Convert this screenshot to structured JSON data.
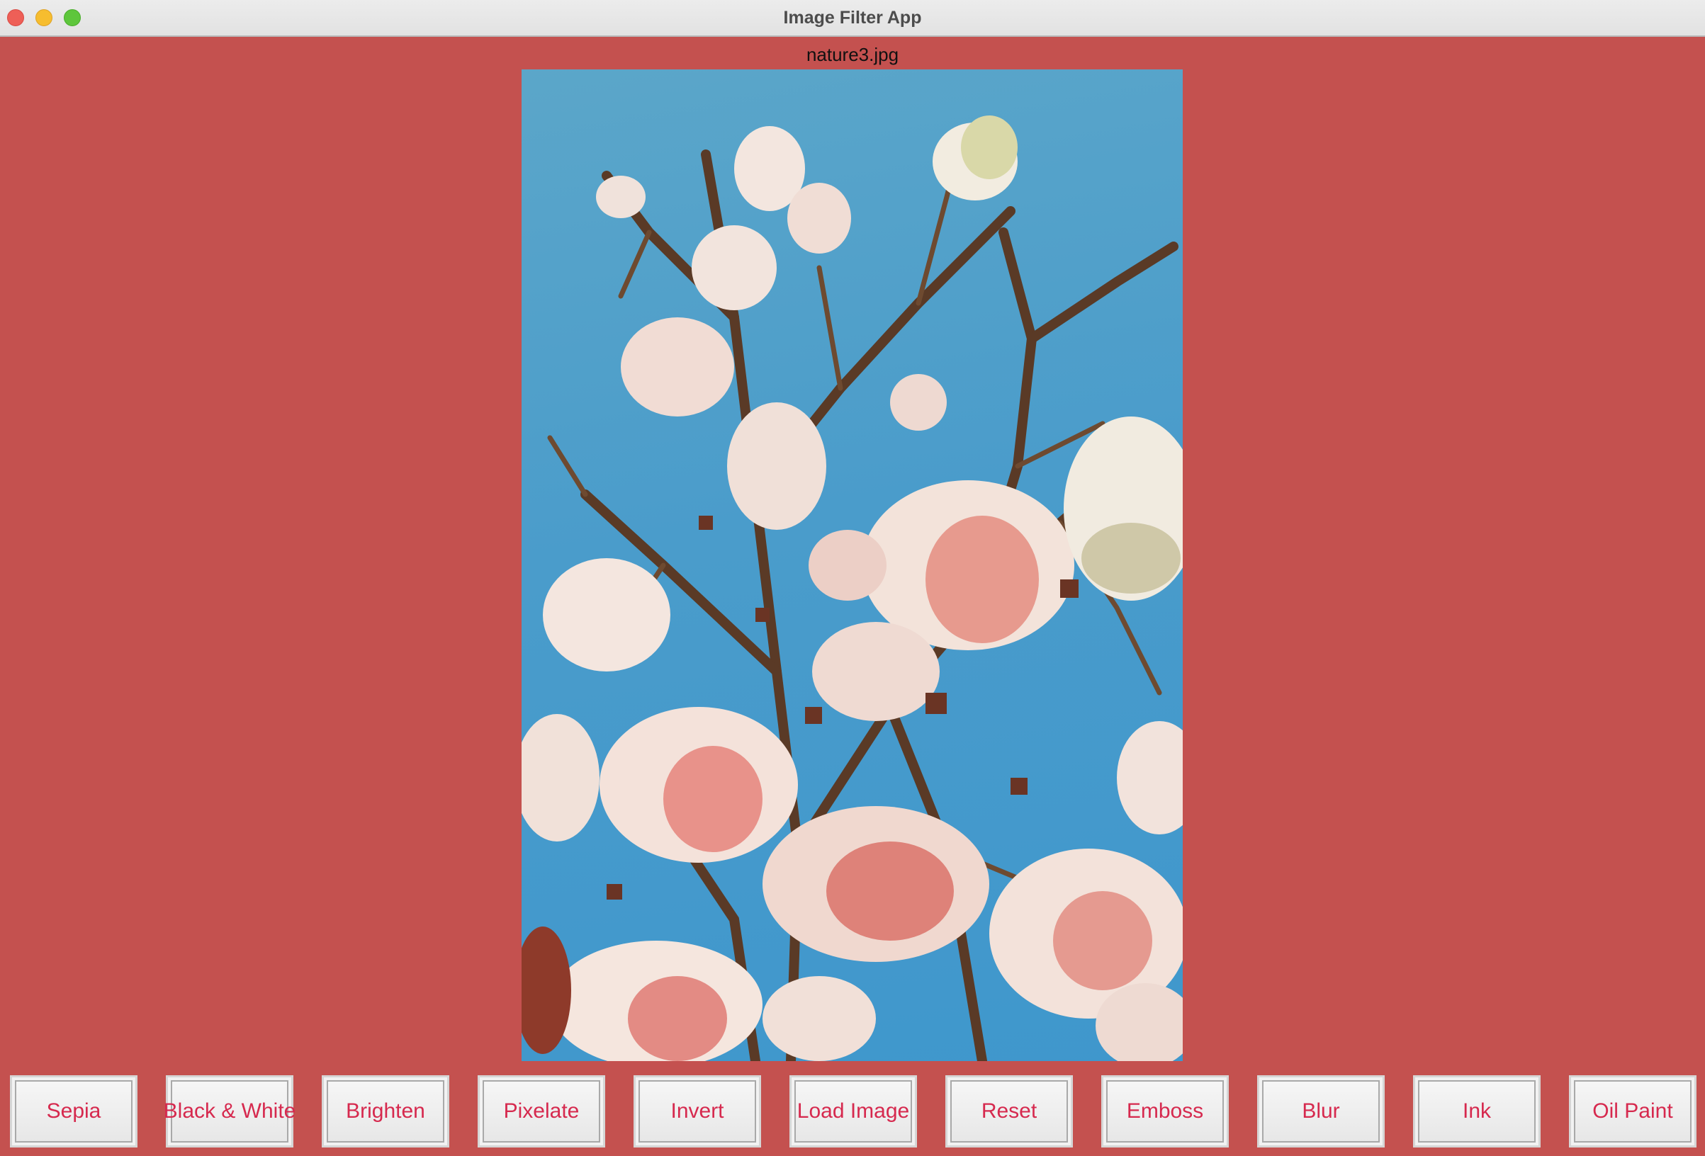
{
  "window": {
    "title": "Image Filter App",
    "controls": [
      "close",
      "minimize",
      "maximize"
    ]
  },
  "image": {
    "filename": "nature3.jpg",
    "description_icon": "photo"
  },
  "buttons": [
    {
      "label": "Sepia"
    },
    {
      "label": "Black & White"
    },
    {
      "label": "Brighten"
    },
    {
      "label": "Pixelate"
    },
    {
      "label": "Invert"
    },
    {
      "label": "Load Image"
    },
    {
      "label": "Reset"
    },
    {
      "label": "Emboss"
    },
    {
      "label": "Blur"
    },
    {
      "label": "Ink"
    },
    {
      "label": "Oil Paint"
    }
  ],
  "colors": {
    "background": "#c4514f",
    "button_text": "#d6294e",
    "sky": "#4a9ccb"
  }
}
